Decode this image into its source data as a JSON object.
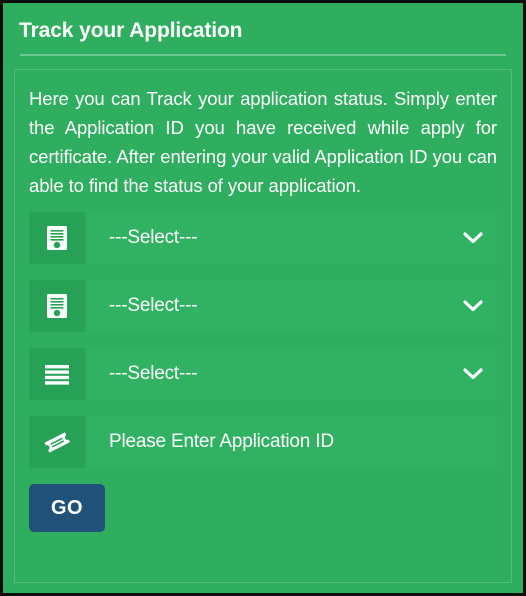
{
  "card": {
    "title": "Track your Application",
    "intro": "Here you can Track your application status. Simply enter the Application ID you have received while apply for certificate. After entering your valid Application ID you can able to find the status of your application."
  },
  "form": {
    "rows": [
      {
        "icon": "certificate-icon",
        "type": "select",
        "name": "certificate-type-select",
        "value": "---Select---",
        "chevron": "chevron-down-icon"
      },
      {
        "icon": "certificate-icon",
        "type": "select",
        "name": "service-select",
        "value": "---Select---",
        "chevron": "chevron-down-icon"
      },
      {
        "icon": "list-bars-icon",
        "type": "select",
        "name": "category-select",
        "value": "---Select---",
        "chevron": "chevron-down-icon"
      },
      {
        "icon": "ticket-icon",
        "type": "text",
        "name": "application-id-input",
        "value": "",
        "placeholder": "Please Enter Application ID"
      }
    ],
    "submit_label": "GO"
  },
  "colors": {
    "panel_green": "#2eae5e",
    "field_green": "#31b262",
    "icon_box_green": "#26a156",
    "divider_green": "#6cc78e",
    "panel_border_green": "#53bd7e",
    "button_blue": "#1f5179",
    "text_white": "#ffffff",
    "outer_border": "#0b0b0b"
  }
}
